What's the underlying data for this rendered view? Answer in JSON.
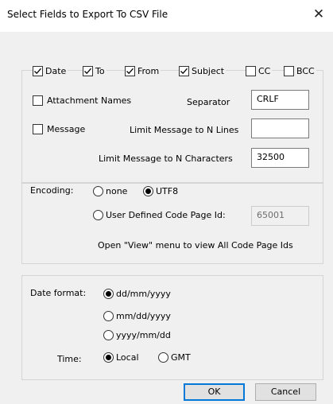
{
  "window": {
    "title": "Select Fields to Export To CSV File",
    "close_icon": "close-icon"
  },
  "fields": [
    {
      "label": "Date",
      "checked": true
    },
    {
      "label": "To",
      "checked": true
    },
    {
      "label": "From",
      "checked": true
    },
    {
      "label": "Subject",
      "checked": true
    },
    {
      "label": "CC",
      "checked": false
    },
    {
      "label": "BCC",
      "checked": false
    }
  ],
  "attachment_names": {
    "label": "Attachment Names",
    "checked": false
  },
  "separator": {
    "label": "Separator",
    "value": "CRLF"
  },
  "message": {
    "label": "Message",
    "checked": false
  },
  "limit_lines": {
    "label": "Limit Message to N Lines",
    "value": ""
  },
  "limit_chars": {
    "label": "Limit Message to N Characters",
    "value": "32500"
  },
  "encoding": {
    "label": "Encoding:",
    "options": [
      {
        "label": "none",
        "selected": false
      },
      {
        "label": "UTF8",
        "selected": true
      }
    ],
    "user_defined": {
      "label": "User Defined Code Page Id:",
      "selected": false,
      "value": "65001"
    },
    "hint": "Open \"View\" menu to view All  Code Page Ids"
  },
  "date_format": {
    "label": "Date format:",
    "options": [
      {
        "label": "dd/mm/yyyy",
        "selected": true
      },
      {
        "label": "mm/dd/yyyy",
        "selected": false
      },
      {
        "label": "yyyy/mm/dd",
        "selected": false
      }
    ]
  },
  "time": {
    "label": "Time:",
    "options": [
      {
        "label": "Local",
        "selected": true
      },
      {
        "label": "GMT",
        "selected": false
      }
    ]
  },
  "buttons": {
    "ok": "OK",
    "cancel": "Cancel"
  }
}
